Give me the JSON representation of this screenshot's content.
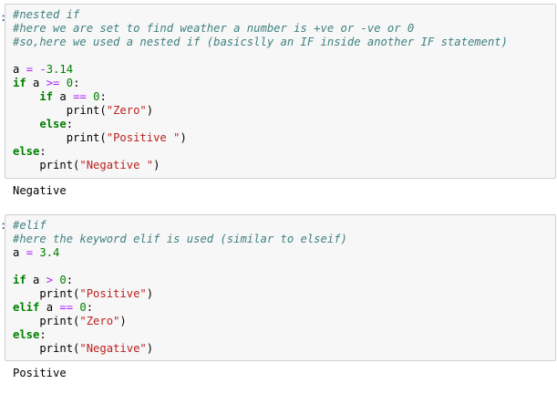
{
  "cell1": {
    "prompt_fragment": ":",
    "lines": [
      [
        {
          "t": "cmt",
          "v": "#nested if"
        }
      ],
      [
        {
          "t": "cmt",
          "v": "#here we are set to find weather a number is +ve or -ve or 0"
        }
      ],
      [
        {
          "t": "cmt",
          "v": "#so,here we used a nested if (basicslly an IF inside another IF statement)"
        }
      ],
      [
        {
          "t": "plain",
          "v": ""
        }
      ],
      [
        {
          "t": "plain",
          "v": "a "
        },
        {
          "t": "op",
          "v": "="
        },
        {
          "t": "plain",
          "v": " "
        },
        {
          "t": "op",
          "v": "-"
        },
        {
          "t": "num",
          "v": "3.14"
        }
      ],
      [
        {
          "t": "kw",
          "v": "if"
        },
        {
          "t": "plain",
          "v": " a "
        },
        {
          "t": "op",
          "v": ">="
        },
        {
          "t": "plain",
          "v": " "
        },
        {
          "t": "num",
          "v": "0"
        },
        {
          "t": "plain",
          "v": ":"
        }
      ],
      [
        {
          "t": "plain",
          "v": "    "
        },
        {
          "t": "kw",
          "v": "if"
        },
        {
          "t": "plain",
          "v": " a "
        },
        {
          "t": "op",
          "v": "=="
        },
        {
          "t": "plain",
          "v": " "
        },
        {
          "t": "num",
          "v": "0"
        },
        {
          "t": "plain",
          "v": ":"
        }
      ],
      [
        {
          "t": "plain",
          "v": "        print("
        },
        {
          "t": "str",
          "v": "\"Zero\""
        },
        {
          "t": "plain",
          "v": ")"
        }
      ],
      [
        {
          "t": "plain",
          "v": "    "
        },
        {
          "t": "kw",
          "v": "else"
        },
        {
          "t": "plain",
          "v": ":"
        }
      ],
      [
        {
          "t": "plain",
          "v": "        print("
        },
        {
          "t": "str",
          "v": "\"Positive \""
        },
        {
          "t": "plain",
          "v": ")"
        }
      ],
      [
        {
          "t": "kw",
          "v": "else"
        },
        {
          "t": "plain",
          "v": ":"
        }
      ],
      [
        {
          "t": "plain",
          "v": "    print("
        },
        {
          "t": "str",
          "v": "\"Negative \""
        },
        {
          "t": "plain",
          "v": ")"
        }
      ]
    ],
    "output": "Negative"
  },
  "cell2": {
    "prompt_fragment": ":",
    "lines": [
      [
        {
          "t": "cmt",
          "v": "#elif"
        }
      ],
      [
        {
          "t": "cmt",
          "v": "#here the keyword elif is used (similar to elseif)"
        }
      ],
      [
        {
          "t": "plain",
          "v": "a "
        },
        {
          "t": "op",
          "v": "="
        },
        {
          "t": "plain",
          "v": " "
        },
        {
          "t": "num",
          "v": "3.4"
        }
      ],
      [
        {
          "t": "plain",
          "v": ""
        }
      ],
      [
        {
          "t": "kw",
          "v": "if"
        },
        {
          "t": "plain",
          "v": " a "
        },
        {
          "t": "op",
          "v": ">"
        },
        {
          "t": "plain",
          "v": " "
        },
        {
          "t": "num",
          "v": "0"
        },
        {
          "t": "plain",
          "v": ":"
        }
      ],
      [
        {
          "t": "plain",
          "v": "    print("
        },
        {
          "t": "str",
          "v": "\"Positive\""
        },
        {
          "t": "plain",
          "v": ")"
        }
      ],
      [
        {
          "t": "kw",
          "v": "elif"
        },
        {
          "t": "plain",
          "v": " a "
        },
        {
          "t": "op",
          "v": "=="
        },
        {
          "t": "plain",
          "v": " "
        },
        {
          "t": "num",
          "v": "0"
        },
        {
          "t": "plain",
          "v": ":"
        }
      ],
      [
        {
          "t": "plain",
          "v": "    print("
        },
        {
          "t": "str",
          "v": "\"Zero\""
        },
        {
          "t": "plain",
          "v": ")"
        }
      ],
      [
        {
          "t": "kw",
          "v": "else"
        },
        {
          "t": "plain",
          "v": ":"
        }
      ],
      [
        {
          "t": "plain",
          "v": "    print("
        },
        {
          "t": "str",
          "v": "\"Negative\""
        },
        {
          "t": "plain",
          "v": ")"
        }
      ]
    ],
    "output": "Positive"
  },
  "colors": {
    "comment": "#408080",
    "keyword": "#008000",
    "operator": "#aa22ff",
    "number": "#008000",
    "string": "#ba2121",
    "cell_background": "#f7f7f7",
    "cell_border": "#cfcfcf"
  }
}
